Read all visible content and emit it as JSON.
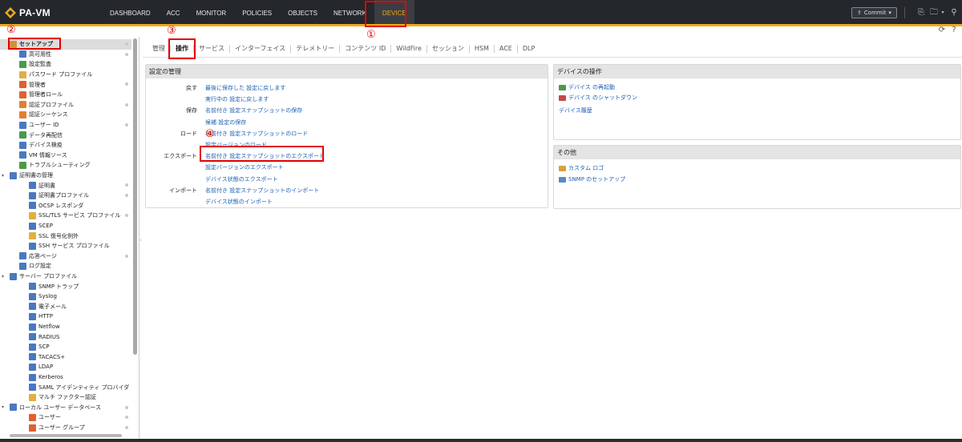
{
  "app": {
    "logo_text": "PA-VM"
  },
  "nav": {
    "items": [
      "DASHBOARD",
      "ACC",
      "MONITOR",
      "POLICIES",
      "OBJECTS",
      "NETWORK",
      "DEVICE"
    ],
    "active": "DEVICE"
  },
  "toolbar": {
    "commit_label": "Commit"
  },
  "annotations": {
    "n1": "①",
    "n2": "②",
    "n3": "③",
    "n4": "④"
  },
  "sidebar": {
    "items": [
      "セットアップ",
      "高可用性",
      "設定監査",
      "パスワード プロファイル",
      "管理者",
      "管理者ロール",
      "認証プロファイル",
      "認証シーケンス",
      "ユーザー ID",
      "データ再配信",
      "デバイス検疫",
      "VM 情報ソース",
      "トラブルシューティング",
      "証明書の管理",
      "証明書",
      "証明書プロファイル",
      "OCSP レスポンダ",
      "SSL/TLS サービス プロファイル",
      "SCEP",
      "SSL 復号化例外",
      "SSH サービス プロファイル",
      "応答ページ",
      "ログ設定",
      "サーバー プロファイル",
      "SNMP トラップ",
      "Syslog",
      "電子メール",
      "HTTP",
      "Netflow",
      "RADIUS",
      "SCP",
      "TACACS+",
      "LDAP",
      "Kerberos",
      "SAML アイデンティティ プロバイダ",
      "マルチ ファクター認証",
      "ローカル ユーザー データベース",
      "ユーザー",
      "ユーザー グループ"
    ]
  },
  "subtabs": [
    "管理",
    "操作",
    "サービス",
    "インターフェイス",
    "テレメトリー",
    "コンテンツ ID",
    "WildFire",
    "セッション",
    "HSM",
    "ACE",
    "DLP"
  ],
  "config_panel": {
    "title": "設定の管理",
    "rows": [
      {
        "label": "戻す",
        "value": "最後に保存した 設定に戻します"
      },
      {
        "label": "",
        "value": "実行中の 設定に戻します"
      },
      {
        "label": "保存",
        "value": "名前付き 設定スナップショットの保存"
      },
      {
        "label": "",
        "value": "候補 設定の保存"
      },
      {
        "label": "ロード",
        "value": "名前付き 設定スナップショットのロード"
      },
      {
        "label": "",
        "value": "設定バージョンのロード"
      },
      {
        "label": "エクスポート",
        "value": "名前付き 設定スナップショットのエクスポート"
      },
      {
        "label": "",
        "value": "設定バージョンのエクスポート"
      },
      {
        "label": "",
        "value": "デバイス状態のエクスポート"
      },
      {
        "label": "インポート",
        "value": "名前付き 設定スナップショットのインポート"
      },
      {
        "label": "",
        "value": "デバイス状態のインポート"
      }
    ]
  },
  "device_panel": {
    "title": "デバイスの操作",
    "links": [
      "デバイス の再起動",
      "デバイス のシャットダウン",
      "デバイス履歴"
    ]
  },
  "other_panel": {
    "title": "その他",
    "links": [
      "カスタム ロゴ",
      "SNMP のセットアップ"
    ]
  },
  "colors": {
    "accent": "#f0a818",
    "link": "#1a5fb4",
    "annotation": "#e30000",
    "topbar": "#24272c"
  }
}
